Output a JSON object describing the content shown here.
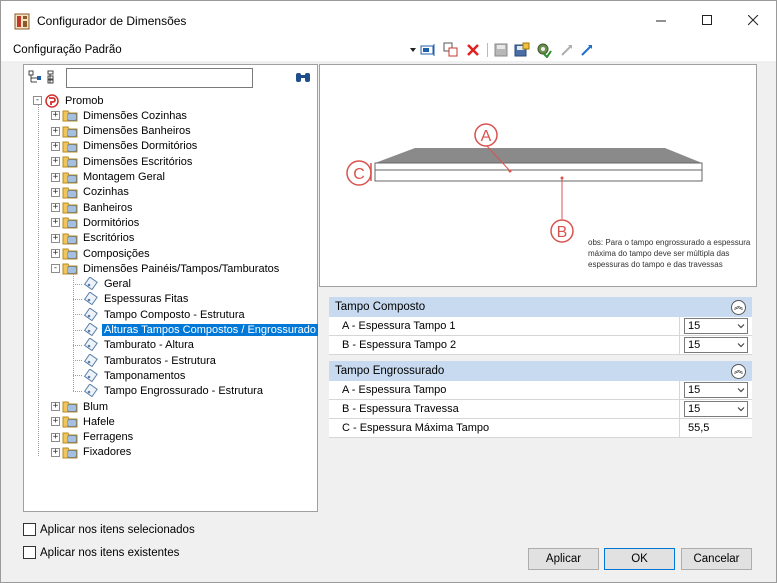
{
  "window": {
    "title": "Configurador de Dimensões",
    "minimize": "—",
    "maximize": "☐",
    "close": "✕"
  },
  "config": {
    "label": "Configuração Padrão"
  },
  "tree": {
    "search_value": "",
    "root": "Promob",
    "items": [
      "Dimensões Cozinhas",
      "Dimensões Banheiros",
      "Dimensões Dormitórios",
      "Dimensões Escritórios",
      "Montagem Geral",
      "Cozinhas",
      "Banheiros",
      "Dormitórios",
      "Escritórios",
      "Composições",
      "Dimensões Painéis/Tampos/Tamburatos"
    ],
    "children": [
      "Geral",
      "Espessuras Fitas",
      "Tampo Composto - Estrutura",
      "Alturas Tampos Compostos / Engrossurado",
      "Tamburato - Altura",
      "Tamburatos - Estrutura",
      "Tamponamentos",
      "Tampo Engrossurado - Estrutura"
    ],
    "items_after": [
      "Blum",
      "Hafele",
      "Ferragens",
      "Fixadores"
    ]
  },
  "diagram": {
    "label_a": "A",
    "label_b": "B",
    "label_c": "C",
    "obs": "obs: Para o tampo engrossurado a espessura máxima do tampo deve ser múltipla das espessuras do tampo e das travessas"
  },
  "groups": {
    "composto": {
      "title": "Tampo Composto",
      "rows": [
        {
          "name": "A - Espessura Tampo 1",
          "value": "15"
        },
        {
          "name": "B - Espessura Tampo 2",
          "value": "15"
        }
      ]
    },
    "engrossurado": {
      "title": "Tampo Engrossurado",
      "rows": [
        {
          "name": "A - Espessura Tampo",
          "value": "15"
        },
        {
          "name": "B - Espessura Travessa",
          "value": "15"
        },
        {
          "name": "C - Espessura Máxima Tampo",
          "value": "55,5"
        }
      ]
    }
  },
  "options": {
    "apply_selected": "Aplicar nos itens selecionados",
    "apply_existing": "Aplicar nos itens existentes"
  },
  "buttons": {
    "apply": "Aplicar",
    "ok": "OK",
    "cancel": "Cancelar"
  },
  "colors": {
    "group_header": "#c8daf0",
    "selection": "#0078d7",
    "diagram_red": "#d9534f"
  }
}
